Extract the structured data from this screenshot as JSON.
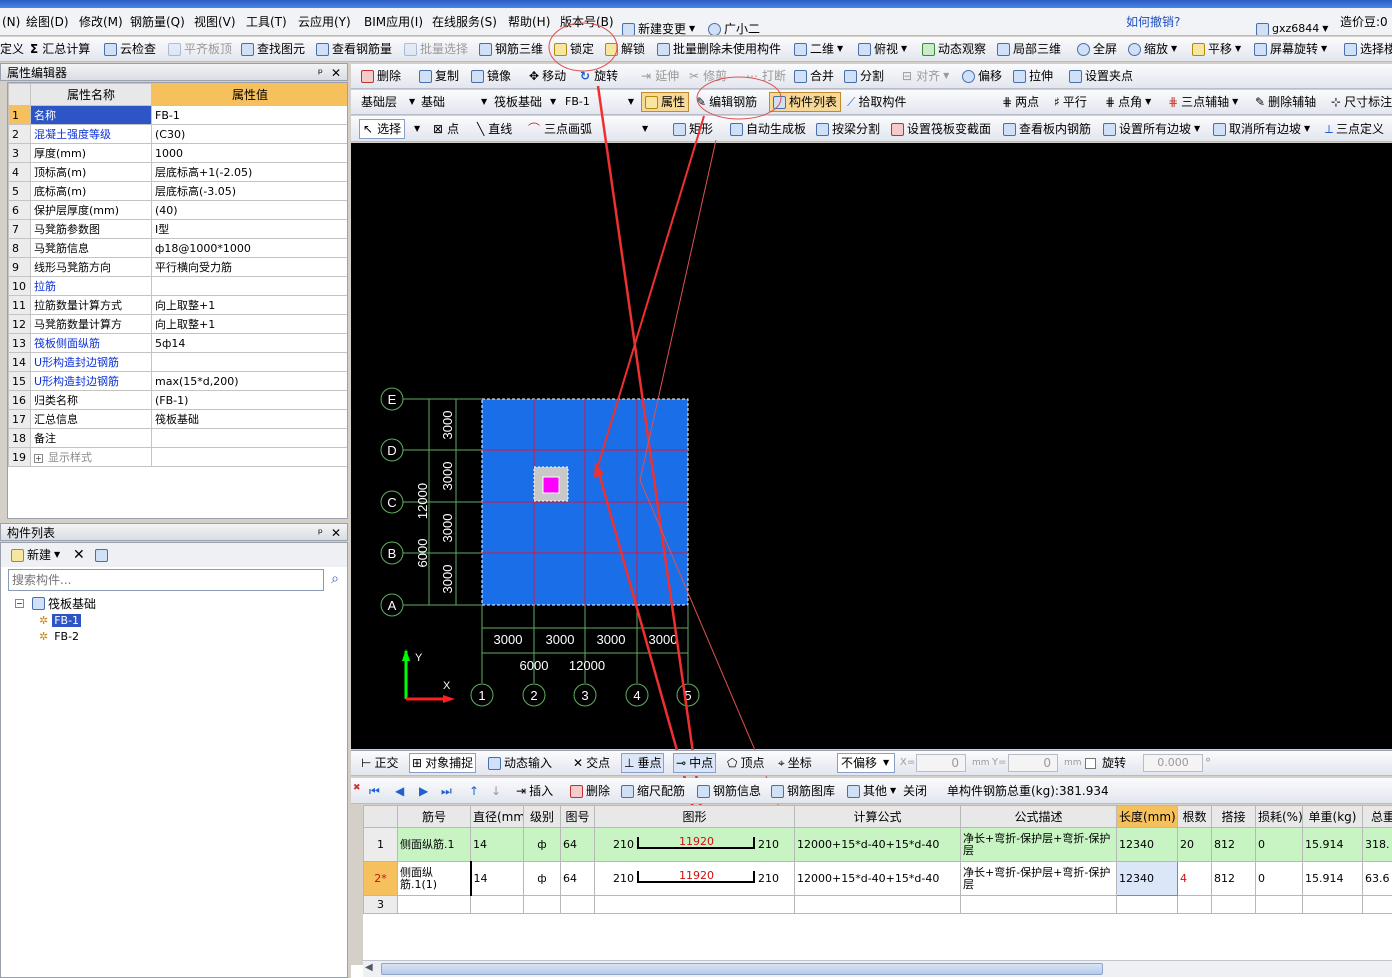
{
  "menu": {
    "items": [
      "(N)",
      "绘图(D)",
      "修改(M)",
      "钢筋量(Q)",
      "视图(V)",
      "工具(T)",
      "云应用(Y)",
      "BIM应用(I)",
      "在线服务(S)",
      "帮助(H)",
      "版本号(B)",
      "新建变更",
      "广小二"
    ],
    "undo_link": "如何撤销?",
    "user": "gxz6844",
    "price": "造价豆:0"
  },
  "toolbar1": {
    "items": [
      "定义",
      "汇总计算",
      "云检查",
      "平齐板顶",
      "查找图元",
      "查看钢筋量",
      "批量选择",
      "钢筋三维",
      "锁定",
      "解锁",
      "批量删除未使用构件",
      "二维",
      "俯视",
      "动态观察",
      "局部三维",
      "全屏",
      "缩放",
      "平移",
      "屏幕旋转",
      "选择楼"
    ]
  },
  "toolbar2": {
    "items": [
      "删除",
      "复制",
      "镜像",
      "移动",
      "旋转",
      "延伸",
      "修剪",
      "打断",
      "合并",
      "分割",
      "对齐",
      "偏移",
      "拉伸",
      "设置夹点"
    ]
  },
  "toolbar3": {
    "floor": "基础层",
    "category": "基础",
    "type": "筏板基础",
    "component": "FB-1",
    "buttons": [
      "属性",
      "编辑钢筋",
      "构件列表",
      "拾取构件"
    ],
    "right": [
      "两点",
      "平行",
      "点角",
      "三点辅轴",
      "删除辅轴",
      "尺寸标注"
    ]
  },
  "toolbar4": {
    "items": [
      "选择",
      "点",
      "直线",
      "三点画弧",
      "矩形",
      "自动生成板",
      "按梁分割",
      "设置筏板变截面",
      "查看板内钢筋",
      "设置所有边坡",
      "取消所有边坡",
      "三点定义"
    ]
  },
  "attr_panel": {
    "title": "属性编辑器",
    "col_name": "属性名称",
    "col_value": "属性值",
    "rows": [
      {
        "n": "1",
        "k": "名称",
        "v": "FB-1",
        "blue": true
      },
      {
        "n": "2",
        "k": "混凝土强度等级",
        "v": "(C30)",
        "blue": true
      },
      {
        "n": "3",
        "k": "厚度(mm)",
        "v": "1000",
        "blue": false
      },
      {
        "n": "4",
        "k": "顶标高(m)",
        "v": "层底标高+1(-2.05)",
        "blue": false
      },
      {
        "n": "5",
        "k": "底标高(m)",
        "v": "层底标高(-3.05)",
        "blue": false
      },
      {
        "n": "6",
        "k": "保护层厚度(mm)",
        "v": "(40)",
        "blue": false
      },
      {
        "n": "7",
        "k": "马凳筋参数图",
        "v": "Ⅰ型",
        "blue": false
      },
      {
        "n": "8",
        "k": "马凳筋信息",
        "v": "ф18@1000*1000",
        "blue": false
      },
      {
        "n": "9",
        "k": "线形马凳筋方向",
        "v": "平行横向受力筋",
        "blue": false
      },
      {
        "n": "10",
        "k": "拉筋",
        "v": "",
        "blue": true
      },
      {
        "n": "11",
        "k": "拉筋数量计算方式",
        "v": "向上取整+1",
        "blue": false
      },
      {
        "n": "12",
        "k": "马凳筋数量计算方",
        "v": "向上取整+1",
        "blue": false
      },
      {
        "n": "13",
        "k": "筏板侧面纵筋",
        "v": "5ф14",
        "blue": true
      },
      {
        "n": "14",
        "k": "U形构造封边钢筋",
        "v": "",
        "blue": true
      },
      {
        "n": "15",
        "k": "U形构造封边钢筋",
        "v": "max(15*d,200)",
        "blue": true
      },
      {
        "n": "16",
        "k": "归类名称",
        "v": "(FB-1)",
        "blue": false
      },
      {
        "n": "17",
        "k": "汇总信息",
        "v": "筏板基础",
        "blue": false
      },
      {
        "n": "18",
        "k": "备注",
        "v": "",
        "blue": false
      },
      {
        "n": "19",
        "k": "显示样式",
        "v": "",
        "blue": false
      }
    ]
  },
  "comp_panel": {
    "title": "构件列表",
    "new_label": "新建",
    "search_placeholder": "搜索构件...",
    "tree_root": "筏板基础",
    "items": [
      "FB-1",
      "FB-2"
    ]
  },
  "cad": {
    "axis_rows": [
      "E",
      "D",
      "C",
      "B",
      "A"
    ],
    "axis_cols": [
      "1",
      "2",
      "3",
      "4",
      "5"
    ],
    "dims_h": [
      "3000",
      "3000",
      "3000",
      "3000"
    ],
    "dims_h2": [
      "6000",
      "12000"
    ],
    "dims_v": [
      "3000",
      "3000",
      "3000",
      "3000"
    ],
    "dims_v2": [
      "6000",
      "12000"
    ],
    "y_label": "Y",
    "x_label": "X",
    "slab_color": "#1a6ee8"
  },
  "status": {
    "items": [
      "正交",
      "对象捕捉",
      "动态输入",
      "交点",
      "垂点",
      "中点",
      "顶点",
      "坐标"
    ],
    "offset": "不偏移",
    "x_label": "X=",
    "x_val": "0",
    "y_label": "Y=",
    "y_val": "0",
    "unit": "mm",
    "rotate": "旋转",
    "rotate_val": "0.000",
    "deg": "°"
  },
  "rebar_bar": {
    "items": [
      "插入",
      "删除",
      "缩尺配筋",
      "钢筋信息",
      "钢筋图库",
      "其他",
      "关闭"
    ],
    "total_label": "单构件钢筋总重(kg):381.934"
  },
  "rebar_table": {
    "headers": [
      "",
      "筋号",
      "直径(mm)",
      "级别",
      "图号",
      "图形",
      "计算公式",
      "公式描述",
      "长度(mm)",
      "根数",
      "搭接",
      "损耗(%)",
      "单重(kg)",
      "总重"
    ],
    "rows": [
      {
        "idx": "1",
        "name": "侧面纵筋.1",
        "dia": "14",
        "grade": "ф",
        "fig": "64",
        "left": "210",
        "mid": "11920",
        "right": "210",
        "formula": "12000+15*d-40+15*d-40",
        "desc": "净长+弯折-保护层+弯折-保护层",
        "len": "12340",
        "count": "20",
        "lap": "812",
        "loss": "0",
        "unit_w": "15.914",
        "total": "318."
      },
      {
        "idx": "2*",
        "name": "侧面纵筋.1(1)",
        "dia": "14",
        "grade": "ф",
        "fig": "64",
        "left": "210",
        "mid": "11920",
        "right": "210",
        "formula": "12000+15*d-40+15*d-40",
        "desc": "净长+弯折-保护层+弯折-保护层",
        "len": "12340",
        "count": "4",
        "lap": "812",
        "loss": "0",
        "unit_w": "15.914",
        "total": "63.6"
      },
      {
        "idx": "3",
        "name": "",
        "dia": "",
        "grade": "",
        "fig": "",
        "left": "",
        "mid": "",
        "right": "",
        "formula": "",
        "desc": "",
        "len": "",
        "count": "",
        "lap": "",
        "loss": "",
        "unit_w": "",
        "total": ""
      }
    ]
  }
}
